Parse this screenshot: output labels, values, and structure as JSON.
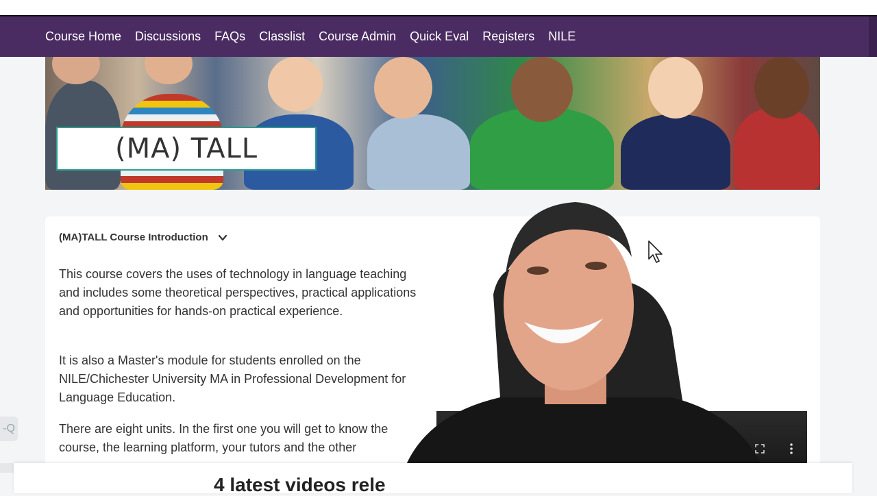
{
  "nav": {
    "items": [
      "Course Home",
      "Discussions",
      "FAQs",
      "Classlist",
      "Course Admin",
      "Quick Eval",
      "Registers",
      "NILE"
    ]
  },
  "banner": {
    "title": "(MA) TALL"
  },
  "intro": {
    "heading": "(MA)TALL Course Introduction",
    "paragraphs": [
      "This course covers the uses of technology in language teaching and includes some theoretical perspectives, practical applications and opportunities for hands-on practical experience.",
      "It is also a Master's module for students enrolled on the NILE/Chichester University MA in Professional Development for Language Education.",
      "There are eight units. In the first one you will get to know the course, the learning platform, your tutors and the other"
    ]
  },
  "side_tab": {
    "label": "-Q"
  },
  "bottom_panel": {
    "text": "4 latest videos rele"
  },
  "colors": {
    "nav_bg": "#4b2c62",
    "accent": "#2a9d8f"
  },
  "icons": [
    "chevron-down-icon",
    "fullscreen-icon",
    "more-vertical-icon",
    "mouse-cursor-icon"
  ]
}
